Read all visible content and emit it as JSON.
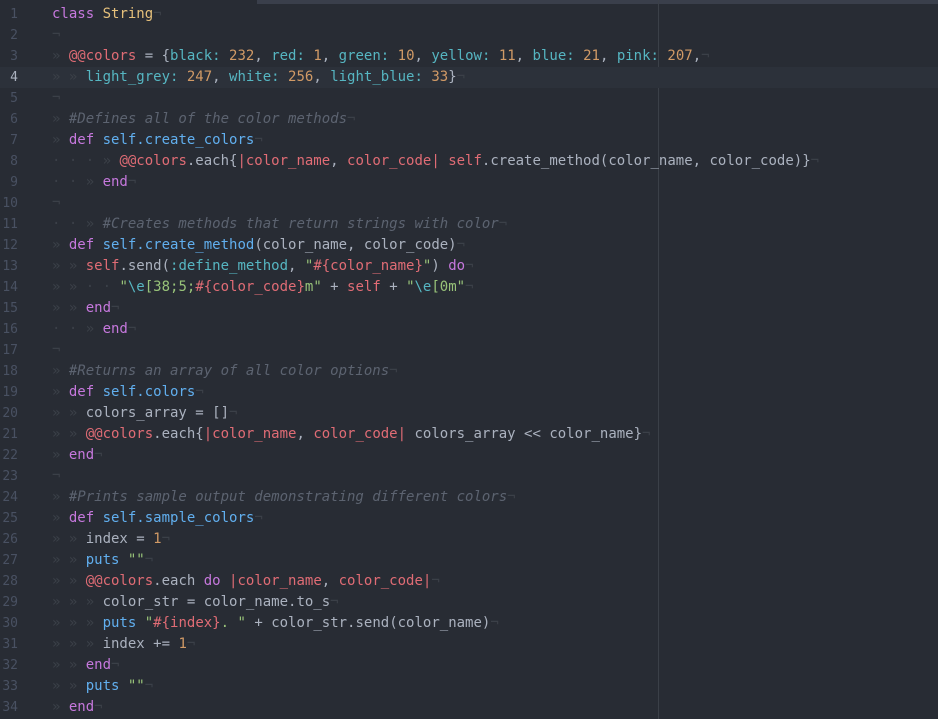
{
  "editor": {
    "cursor_line": 4,
    "lines": [
      {
        "n": "1",
        "tokens": [
          [
            "kw",
            "class"
          ],
          [
            "",
            "&nbsp;"
          ],
          [
            "cls",
            "String"
          ],
          [
            "inv",
            "¬"
          ]
        ]
      },
      {
        "n": "2",
        "tokens": [
          [
            "inv",
            "¬"
          ]
        ]
      },
      {
        "n": "3",
        "tokens": [
          [
            "inv",
            "» "
          ],
          [
            "ivar",
            "@@colors"
          ],
          [
            "",
            " = {"
          ],
          [
            "sym",
            "black: "
          ],
          [
            "num",
            "232"
          ],
          [
            "",
            ", "
          ],
          [
            "sym",
            "red: "
          ],
          [
            "num",
            "1"
          ],
          [
            "",
            ", "
          ],
          [
            "sym",
            "green: "
          ],
          [
            "num",
            "10"
          ],
          [
            "",
            ", "
          ],
          [
            "sym",
            "yellow: "
          ],
          [
            "num",
            "11"
          ],
          [
            "",
            ", "
          ],
          [
            "sym",
            "blue: "
          ],
          [
            "num",
            "21"
          ],
          [
            "",
            ", "
          ],
          [
            "sym",
            "pink: "
          ],
          [
            "num",
            "207"
          ],
          [
            "",
            ","
          ],
          [
            "inv",
            "¬"
          ]
        ]
      },
      {
        "n": "4",
        "tokens": [
          [
            "inv",
            "» » "
          ],
          [
            "sym",
            "light_grey: "
          ],
          [
            "num",
            "247"
          ],
          [
            "",
            ", "
          ],
          [
            "sym",
            "white: "
          ],
          [
            "num",
            "256"
          ],
          [
            "",
            ", "
          ],
          [
            "sym",
            "light_blue: "
          ],
          [
            "num",
            "33"
          ],
          [
            "",
            "}"
          ],
          [
            "inv",
            "¬"
          ]
        ]
      },
      {
        "n": "5",
        "tokens": [
          [
            "inv",
            "¬"
          ]
        ]
      },
      {
        "n": "6",
        "tokens": [
          [
            "inv",
            "» "
          ],
          [
            "cm",
            "#Defines all of the color methods"
          ],
          [
            "inv",
            "¬"
          ]
        ]
      },
      {
        "n": "7",
        "tokens": [
          [
            "inv",
            "» "
          ],
          [
            "kw",
            "def"
          ],
          [
            "",
            " "
          ],
          [
            "fn",
            "self.create_colors"
          ],
          [
            "inv",
            "¬"
          ]
        ]
      },
      {
        "n": "8",
        "tokens": [
          [
            "inv",
            "· · · » "
          ],
          [
            "ivar",
            "@@colors"
          ],
          [
            "",
            ".each{"
          ],
          [
            "var",
            "|color_name"
          ],
          [
            "",
            ", "
          ],
          [
            "var",
            "color_code|"
          ],
          [
            "",
            ""
          ],
          [
            "",
            " "
          ],
          [
            "var",
            "self"
          ],
          [
            "",
            ".create_method(color_name, color_code)}"
          ],
          [
            "inv",
            "¬"
          ]
        ]
      },
      {
        "n": "9",
        "tokens": [
          [
            "inv",
            "· · » "
          ],
          [
            "kw",
            "end"
          ],
          [
            "inv",
            "¬"
          ]
        ]
      },
      {
        "n": "10",
        "tokens": [
          [
            "inv",
            "¬"
          ]
        ]
      },
      {
        "n": "11",
        "tokens": [
          [
            "inv",
            "· · » "
          ],
          [
            "cm",
            "#Creates methods that return strings with color"
          ],
          [
            "inv",
            "¬"
          ]
        ]
      },
      {
        "n": "12",
        "tokens": [
          [
            "inv",
            "» "
          ],
          [
            "kw",
            "def"
          ],
          [
            "",
            " "
          ],
          [
            "fn",
            "self.create_method"
          ],
          [
            "",
            "(color_name, color_code)"
          ],
          [
            "inv",
            "¬"
          ]
        ]
      },
      {
        "n": "13",
        "tokens": [
          [
            "inv",
            "» » "
          ],
          [
            "var",
            "self"
          ],
          [
            "",
            ".send("
          ],
          [
            "sym",
            ":define_method"
          ],
          [
            "",
            ", "
          ],
          [
            "str",
            "\""
          ],
          [
            "var",
            "#{color_name}"
          ],
          [
            "str",
            "\""
          ],
          [
            "",
            ") "
          ],
          [
            "kw",
            "do"
          ],
          [
            "inv",
            "¬"
          ]
        ]
      },
      {
        "n": "14",
        "tokens": [
          [
            "inv",
            "» » · · "
          ],
          [
            "str",
            "\""
          ],
          [
            "esc",
            "\\e"
          ],
          [
            "str",
            "[38;5;"
          ],
          [
            "var",
            "#{color_code}"
          ],
          [
            "str",
            "m\""
          ],
          [
            "",
            " + "
          ],
          [
            "var",
            "self"
          ],
          [
            "",
            " + "
          ],
          [
            "str",
            "\""
          ],
          [
            "esc",
            "\\e"
          ],
          [
            "str",
            "[0m\""
          ],
          [
            "inv",
            "¬"
          ]
        ]
      },
      {
        "n": "15",
        "tokens": [
          [
            "inv",
            "» » "
          ],
          [
            "kw",
            "end"
          ],
          [
            "inv",
            "¬"
          ]
        ]
      },
      {
        "n": "16",
        "tokens": [
          [
            "inv",
            "· · » "
          ],
          [
            "kw",
            "end"
          ],
          [
            "inv",
            "¬"
          ]
        ]
      },
      {
        "n": "17",
        "tokens": [
          [
            "inv",
            "¬"
          ]
        ]
      },
      {
        "n": "18",
        "tokens": [
          [
            "inv",
            "» "
          ],
          [
            "cm",
            "#Returns an array of all color options"
          ],
          [
            "inv",
            "¬"
          ]
        ]
      },
      {
        "n": "19",
        "tokens": [
          [
            "inv",
            "» "
          ],
          [
            "kw",
            "def"
          ],
          [
            "",
            " "
          ],
          [
            "fn",
            "self.colors"
          ],
          [
            "inv",
            "¬"
          ]
        ]
      },
      {
        "n": "20",
        "tokens": [
          [
            "inv",
            "» » "
          ],
          [
            "",
            "colors_array = []"
          ],
          [
            "inv",
            "¬"
          ]
        ]
      },
      {
        "n": "21",
        "tokens": [
          [
            "inv",
            "» » "
          ],
          [
            "ivar",
            "@@colors"
          ],
          [
            "",
            ".each{"
          ],
          [
            "var",
            "|color_name"
          ],
          [
            "",
            ", "
          ],
          [
            "var",
            "color_code|"
          ],
          [
            "",
            " colors_array << color_name}"
          ],
          [
            "inv",
            "¬"
          ]
        ]
      },
      {
        "n": "22",
        "tokens": [
          [
            "inv",
            "» "
          ],
          [
            "kw",
            "end"
          ],
          [
            "inv",
            "¬"
          ]
        ]
      },
      {
        "n": "23",
        "tokens": [
          [
            "inv",
            "¬"
          ]
        ]
      },
      {
        "n": "24",
        "tokens": [
          [
            "inv",
            "» "
          ],
          [
            "cm",
            "#Prints sample output demonstrating different colors"
          ],
          [
            "inv",
            "¬"
          ]
        ]
      },
      {
        "n": "25",
        "tokens": [
          [
            "inv",
            "» "
          ],
          [
            "kw",
            "def"
          ],
          [
            "",
            " "
          ],
          [
            "fn",
            "self.sample_colors"
          ],
          [
            "inv",
            "¬"
          ]
        ]
      },
      {
        "n": "26",
        "tokens": [
          [
            "inv",
            "» » "
          ],
          [
            "",
            "index = "
          ],
          [
            "num",
            "1"
          ],
          [
            "inv",
            "¬"
          ]
        ]
      },
      {
        "n": "27",
        "tokens": [
          [
            "inv",
            "» » "
          ],
          [
            "fn",
            "puts"
          ],
          [
            "",
            " "
          ],
          [
            "str",
            "\"\""
          ],
          [
            "inv",
            "¬"
          ]
        ]
      },
      {
        "n": "28",
        "tokens": [
          [
            "inv",
            "» » "
          ],
          [
            "ivar",
            "@@colors"
          ],
          [
            "",
            ".each "
          ],
          [
            "kw",
            "do"
          ],
          [
            "",
            " "
          ],
          [
            "var",
            "|color_name"
          ],
          [
            "",
            ", "
          ],
          [
            "var",
            "color_code|"
          ],
          [
            "inv",
            "¬"
          ]
        ]
      },
      {
        "n": "29",
        "tokens": [
          [
            "inv",
            "» » » "
          ],
          [
            "",
            "color_str = color_name.to_s"
          ],
          [
            "inv",
            "¬"
          ]
        ]
      },
      {
        "n": "30",
        "tokens": [
          [
            "inv",
            "» » » "
          ],
          [
            "fn",
            "puts"
          ],
          [
            "",
            " "
          ],
          [
            "str",
            "\""
          ],
          [
            "var",
            "#{index}"
          ],
          [
            "str",
            ". \""
          ],
          [
            "",
            " + color_str.send(color_name)"
          ],
          [
            "inv",
            "¬"
          ]
        ]
      },
      {
        "n": "31",
        "tokens": [
          [
            "inv",
            "» » » "
          ],
          [
            "",
            "index += "
          ],
          [
            "num",
            "1"
          ],
          [
            "inv",
            "¬"
          ]
        ]
      },
      {
        "n": "32",
        "tokens": [
          [
            "inv",
            "» » "
          ],
          [
            "kw",
            "end"
          ],
          [
            "inv",
            "¬"
          ]
        ]
      },
      {
        "n": "33",
        "tokens": [
          [
            "inv",
            "» » "
          ],
          [
            "fn",
            "puts"
          ],
          [
            "",
            " "
          ],
          [
            "str",
            "\"\""
          ],
          [
            "inv",
            "¬"
          ]
        ]
      },
      {
        "n": "34",
        "tokens": [
          [
            "inv",
            "» "
          ],
          [
            "kw",
            "end"
          ],
          [
            "inv",
            "¬"
          ]
        ]
      }
    ]
  },
  "theme": {
    "background": "#282c34",
    "keyword": "#c678dd",
    "class_name": "#e5c07b",
    "instance_var": "#e06c75",
    "symbol": "#56b6c2",
    "number": "#d19a66",
    "function": "#61afef",
    "string": "#98c379",
    "comment": "#5c6370"
  }
}
